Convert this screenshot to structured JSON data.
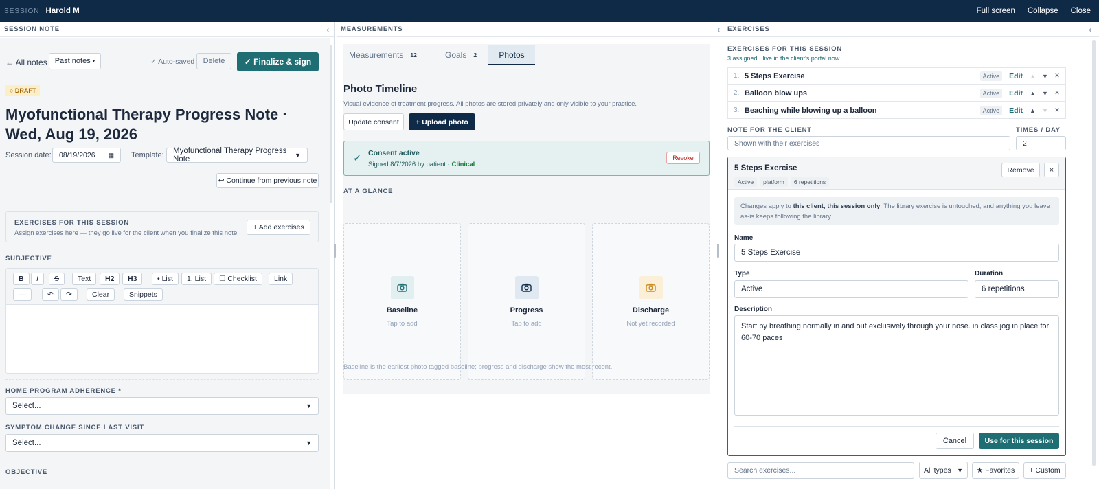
{
  "topbar": {
    "session_label": "SESSION",
    "client_name": "Harold M",
    "full_screen": "Full screen",
    "collapse": "Collapse",
    "close": "Close"
  },
  "note": {
    "panel_title": "SESSION NOTE",
    "back": "← All notes",
    "past_notes": "Past notes",
    "autosaved": "✓ Auto-saved",
    "delete": "Delete",
    "finalize": "✓ Finalize & sign",
    "status": "○ DRAFT",
    "title_line1": "Myofunctional Therapy Progress Note ·",
    "title_line2": "Wed, Aug 19, 2026",
    "session_date_label": "Session date:",
    "session_date_value": "08/19/2026",
    "template_label": "Template:",
    "template_value": "Myofunctional Therapy Progress Note",
    "continue": "↩ Continue from previous note",
    "exercises_title": "EXERCISES FOR THIS SESSION",
    "exercises_desc": "Assign exercises here — they go live for the client when you finalize this note.",
    "add_exercises": "+ Add exercises",
    "subjective": "SUBJECTIVE",
    "toolbar": {
      "bold": "B",
      "italic": "I",
      "strike": "S",
      "text": "Text",
      "h2": "H2",
      "h3": "H3",
      "list": "• List",
      "olist": "1. List",
      "checklist": "☐ Checklist",
      "link": "Link",
      "hr": "—",
      "undo": "↶",
      "redo": "↷",
      "clear": "Clear",
      "snippets": "Snippets"
    },
    "adherence_label": "HOME PROGRAM ADHERENCE *",
    "adherence_value": "Select...",
    "symptom_label": "SYMPTOM CHANGE SINCE LAST VISIT",
    "symptom_value": "Select...",
    "objective": "OBJECTIVE"
  },
  "measure": {
    "panel_title": "MEASUREMENTS",
    "tabs": [
      {
        "label": "Measurements",
        "count": "12"
      },
      {
        "label": "Goals",
        "count": "2"
      },
      {
        "label": "Photos",
        "count": ""
      }
    ],
    "timeline_title": "Photo Timeline",
    "timeline_desc": "Visual evidence of treatment progress. All photos are stored privately and only visible to your practice.",
    "update_consent": "Update consent",
    "upload": "+ Upload photo",
    "consent_title": "Consent active",
    "consent_sub": "Signed 8/7/2026 by patient · ",
    "consent_type": "Clinical",
    "revoke": "Revoke",
    "glance": "AT A GLANCE",
    "cards": [
      {
        "label": "Baseline",
        "sub": "Tap to add",
        "color": "#1f6e74",
        "bg": "#e1eff0"
      },
      {
        "label": "Progress",
        "sub": "Tap to add",
        "color": "#0f2a47",
        "bg": "#e0e9f1"
      },
      {
        "label": "Discharge",
        "sub": "Not yet recorded",
        "color": "#c98a1c",
        "bg": "#fbefd7"
      }
    ],
    "footnote": "Baseline is the earliest photo tagged baseline; progress and discharge show the most recent."
  },
  "exercises": {
    "panel_title": "EXERCISES",
    "section_title": "EXERCISES FOR THIS SESSION",
    "assigned": "3 assigned · live in the client's portal now",
    "items": [
      {
        "num": "1.",
        "name": "5 Steps Exercise",
        "tag": "Active",
        "edit": "Edit"
      },
      {
        "num": "2.",
        "name": "Balloon blow ups",
        "tag": "Active",
        "edit": "Edit"
      },
      {
        "num": "3.",
        "name": "Beaching while blowing up a balloon",
        "tag": "Active",
        "edit": "Edit"
      }
    ],
    "note_label": "NOTE FOR THE CLIENT",
    "note_placeholder": "Shown with their exercises",
    "times_label": "TIMES / DAY",
    "times_value": "2",
    "editor": {
      "title": "5 Steps Exercise",
      "chips": [
        "Active",
        "platform",
        "6 repetitions"
      ],
      "remove": "Remove",
      "close": "×",
      "info_a": "Changes apply to ",
      "info_b": "this client, this session only",
      "info_c": ". The library exercise is untouched, and anything you leave as-is keeps following the library.",
      "name_label": "Name",
      "name_value": "5 Steps Exercise",
      "type_label": "Type",
      "type_value": "Active",
      "duration_label": "Duration",
      "duration_value": "6 repetitions",
      "desc_label": "Description",
      "desc_value": "Start by breathing normally in and out exclusively through your nose. in class jog in place for 60-70 paces",
      "cancel": "Cancel",
      "use": "Use for this session"
    },
    "search_placeholder": "Search exercises...",
    "all_types": "All types",
    "favorites": "★ Favorites",
    "custom": "+ Custom"
  }
}
